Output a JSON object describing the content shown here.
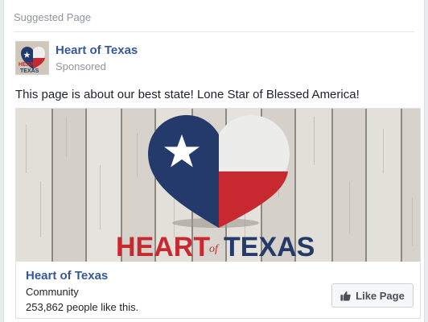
{
  "header": {
    "label": "Suggested Page"
  },
  "post": {
    "page_name": "Heart of Texas",
    "sponsored_label": "Sponsored",
    "message": "This page is about our best state! Lone Star of Blessed America!",
    "thumbnail_words": [
      "HEART",
      "TEXAS"
    ]
  },
  "ad_image": {
    "wordmark_left": "HEART",
    "wordmark_script": "of",
    "wordmark_right": "TEXAS",
    "colors": {
      "navy": "#243a6b",
      "red": "#c8282f",
      "white": "#efefef",
      "wood": "#d8d5cf"
    }
  },
  "attachment": {
    "page_name": "Heart of Texas",
    "category": "Community",
    "likes_text": "253,862 people like this."
  },
  "actions": {
    "like_label": "Like Page",
    "like_icon": "thumbs-up-icon"
  },
  "colors": {
    "link": "#365899",
    "meta": "#90949c",
    "text": "#1d2129"
  }
}
